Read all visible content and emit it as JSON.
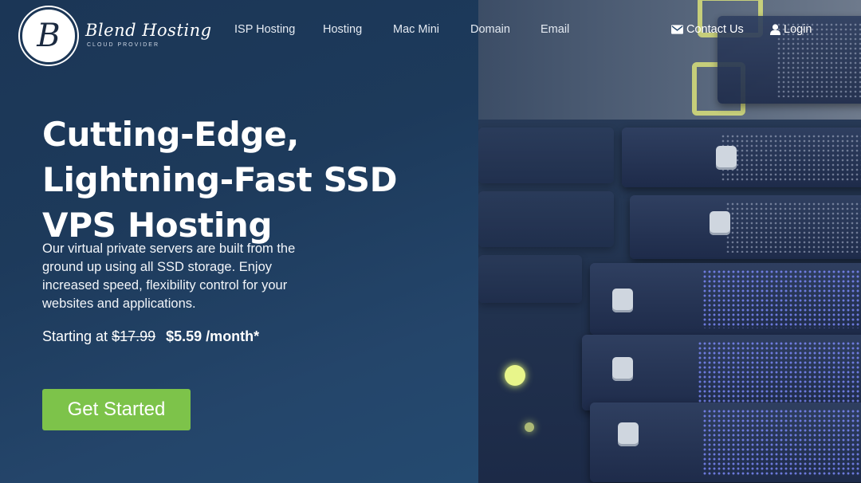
{
  "brand": {
    "monogram": "B",
    "name": "Blend Hosting",
    "tagline": "CLOUD PROVIDER"
  },
  "nav": {
    "items": [
      {
        "label": "ISP Hosting"
      },
      {
        "label": "Hosting"
      },
      {
        "label": "Mac Mini"
      },
      {
        "label": "Domain"
      },
      {
        "label": "Email"
      }
    ],
    "contact_label": "Contact Us",
    "login_label": "Login"
  },
  "hero": {
    "title": "Cutting-Edge, Lightning-Fast SSD VPS Hosting",
    "description": "Our virtual private servers are built from the ground up using all SSD storage. Enjoy increased speed, flexibility control for your websites and applications.",
    "price_prefix": "Starting at",
    "old_price": "$17.99",
    "new_price": "$5.59 /month*",
    "cta_label": "Get Started"
  },
  "colors": {
    "accent_green": "#7dc34a",
    "background_navy": "#1d3a5b"
  },
  "icons": {
    "contact": "envelope-icon",
    "login": "user-icon"
  }
}
